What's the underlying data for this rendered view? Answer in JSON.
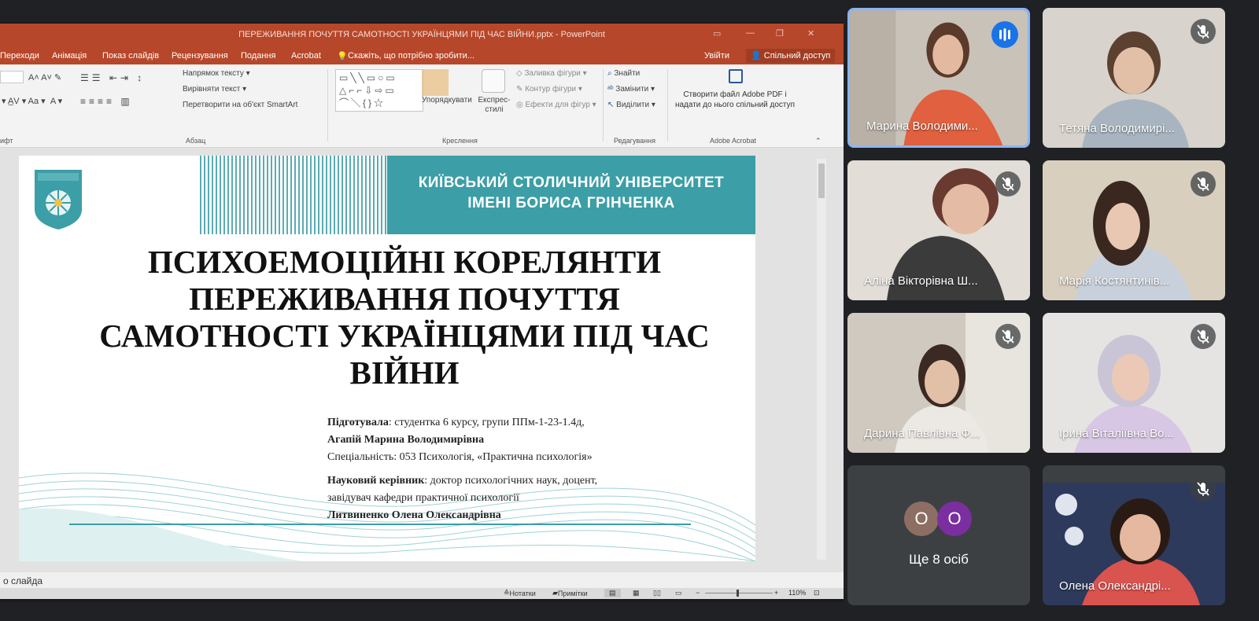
{
  "ppt": {
    "window_title": "ПЕРЕЖИВАННЯ ПОЧУТТЯ САМОТНОСТІ УКРАЇНЦЯМИ ПІД ЧАС ВІЙНИ.pptx - PowerPoint",
    "menu": [
      "Переходи",
      "Анімація",
      "Показ слайдів",
      "Рецензування",
      "Подання",
      "Acrobat"
    ],
    "tell_me": "Скажіть, що потрібно зробити...",
    "sign_in": "Увійти",
    "share": "Спільний доступ",
    "ribbon": {
      "text_direction": "Напрямок тексту",
      "align_text": "Вирівняти текст",
      "convert_smartart": "Перетворити на об'єкт SmartArt",
      "group_font": "ифт",
      "group_paragraph": "Абзац",
      "arrange": "Упорядкувати",
      "quick_styles": "Експрес-стилі",
      "shape_fill": "Заливка фігури",
      "shape_outline": "Контур фігури",
      "shape_effects": "Ефекти для фігур",
      "group_drawing": "Креслення",
      "find": "Знайти",
      "replace": "Замінити",
      "select": "Виділити",
      "group_editing": "Редагування",
      "adobe_create": "Створити файл Adobe PDF і надати до нього спільний доступ",
      "group_adobe": "Adobe Acrobat"
    },
    "slide": {
      "university": [
        "КИЇВСЬКИЙ СТОЛИЧНИЙ УНІВЕРСИТЕТ",
        "ІМЕНІ БОРИСА ГРІНЧЕНКА"
      ],
      "title": "ПСИХОЕМОЦІЙНІ КОРЕЛЯНТИ ПЕРЕЖИВАННЯ ПОЧУТТЯ САМОТНОСТІ УКРАЇНЦЯМИ ПІД ЧАС ВІЙНИ",
      "prepared_label": "Підготувала",
      "prepared_text": ": студентка 6 курсу, групи ППм-1-23-1.4д,",
      "author": "Агапій Марина Володимирівна",
      "specialty": "Спеціальність: 053 Психологія,  «Практична психологія»",
      "supervisor_label": "Науковий керівник",
      "supervisor_text": ":  доктор психологічних наук, доцент,",
      "supervisor_role": "завідувач кафедри практичної психології",
      "supervisor_name": "Литвиненко Олена Олександрівна"
    },
    "notes_placeholder": "о слайда",
    "status": {
      "notes": "Нотатки",
      "comments": "Примітки",
      "zoom": "110%"
    }
  },
  "participants": [
    {
      "name": "Марина Володими...",
      "speaking": true
    },
    {
      "name": "Тетяна Володимирі...",
      "muted": true
    },
    {
      "name": "Аліна Вікторівна Ш...",
      "muted": true
    },
    {
      "name": "Марія Костянтинів...",
      "muted": true
    },
    {
      "name": "Дарина Павлівна Ф...",
      "muted": true
    },
    {
      "name": "Ірина Віталіївна Во...",
      "muted": true
    },
    {
      "name": "Олена Олександрі...",
      "muted": true
    }
  ],
  "more": {
    "avatars": [
      "О",
      "О"
    ],
    "label": "Ще 8 осіб"
  }
}
